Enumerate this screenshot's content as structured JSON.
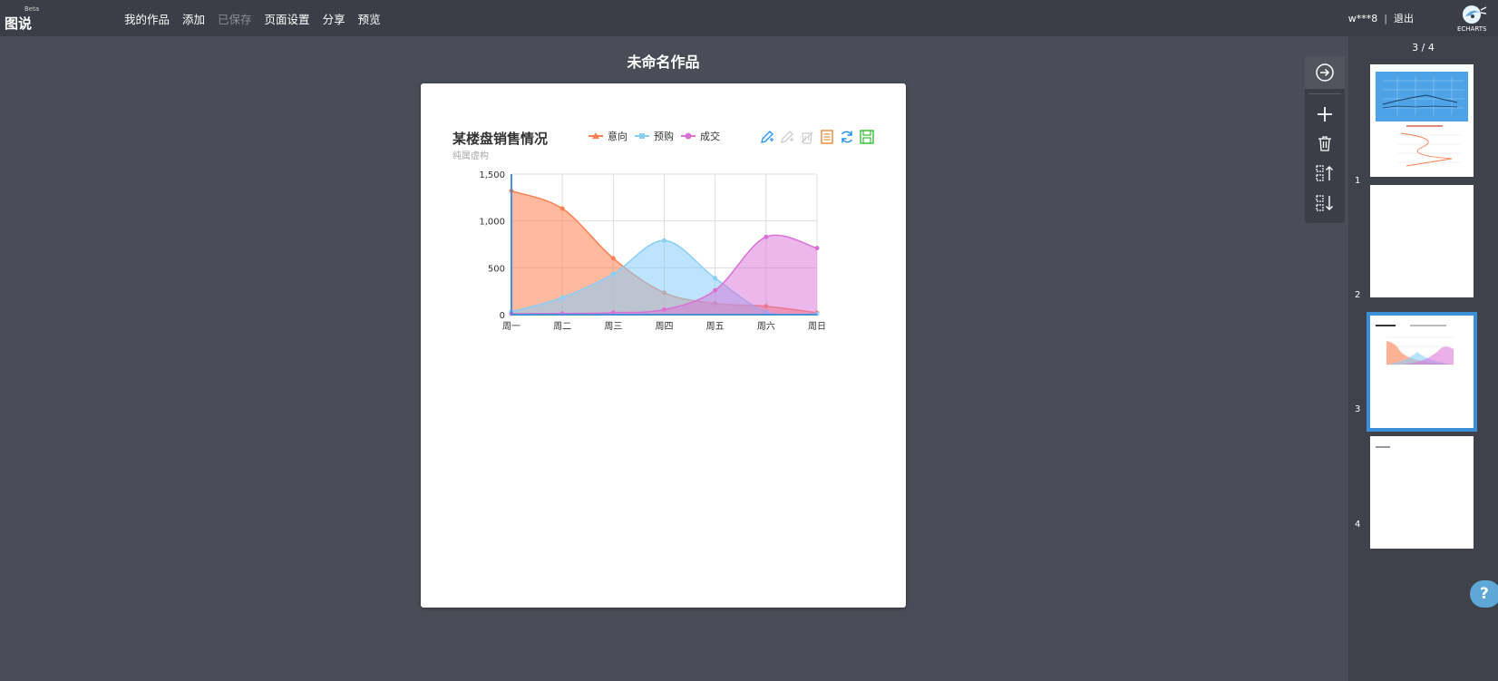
{
  "app": {
    "beta": "Beta",
    "name": "图说"
  },
  "menu": {
    "items": [
      {
        "label": "我的作品",
        "disabled": false
      },
      {
        "label": "添加",
        "disabled": false
      },
      {
        "label": "已保存",
        "disabled": true
      },
      {
        "label": "页面设置",
        "disabled": false
      },
      {
        "label": "分享",
        "disabled": false
      },
      {
        "label": "预览",
        "disabled": false
      }
    ]
  },
  "user": {
    "name": "w***8",
    "separator": "|",
    "logout": "退出"
  },
  "brand": {
    "logo_text": "ECHARTS"
  },
  "document": {
    "title": "未命名作品"
  },
  "tools": [
    {
      "icon": "arrow-right-circle-icon"
    },
    {
      "icon": "plus-icon"
    },
    {
      "icon": "trash-icon"
    },
    {
      "icon": "move-up-icon"
    },
    {
      "icon": "move-down-icon"
    }
  ],
  "thumbnails": {
    "counter": "3 / 4",
    "pages": [
      {
        "number": "1"
      },
      {
        "number": "2"
      },
      {
        "number": "3",
        "selected": true
      },
      {
        "number": "4"
      }
    ]
  },
  "help": {
    "label": "?"
  },
  "chart_data": {
    "type": "area",
    "title": "某楼盘销售情况",
    "subtitle": "纯属虚构",
    "categories": [
      "周一",
      "周二",
      "周三",
      "周四",
      "周五",
      "周六",
      "周日"
    ],
    "ylim": [
      0,
      1500
    ],
    "yticks": [
      0,
      500,
      1000,
      1500
    ],
    "ytick_labels": [
      "0",
      "500",
      "1,000",
      "1,500"
    ],
    "grid": true,
    "smooth": true,
    "legend_position": "top",
    "series": [
      {
        "name": "意向",
        "color": "#ff7f50",
        "fill": "rgba(255,127,80,0.55)",
        "symbol": "triangle",
        "values": [
          1320,
          1132,
          601,
          234,
          120,
          90,
          20
        ]
      },
      {
        "name": "预购",
        "color": "#87cefa",
        "fill": "rgba(135,206,250,0.55)",
        "symbol": "square",
        "values": [
          30,
          182,
          434,
          791,
          390,
          30,
          10
        ]
      },
      {
        "name": "成交",
        "color": "#da70d6",
        "fill": "rgba(218,112,214,0.5)",
        "symbol": "circle",
        "values": [
          10,
          12,
          21,
          54,
          260,
          830,
          710
        ]
      }
    ],
    "toolbox": [
      {
        "icon": "mark-pen-icon",
        "color": "#1e90ff"
      },
      {
        "icon": "mark-undo-icon",
        "color": "#cccccc"
      },
      {
        "icon": "mark-clear-icon",
        "color": "#cccccc"
      },
      {
        "icon": "data-view-icon",
        "color": "#e67e22"
      },
      {
        "icon": "restore-icon",
        "color": "#1e90ff"
      },
      {
        "icon": "save-image-icon",
        "color": "#22bb22"
      }
    ]
  }
}
